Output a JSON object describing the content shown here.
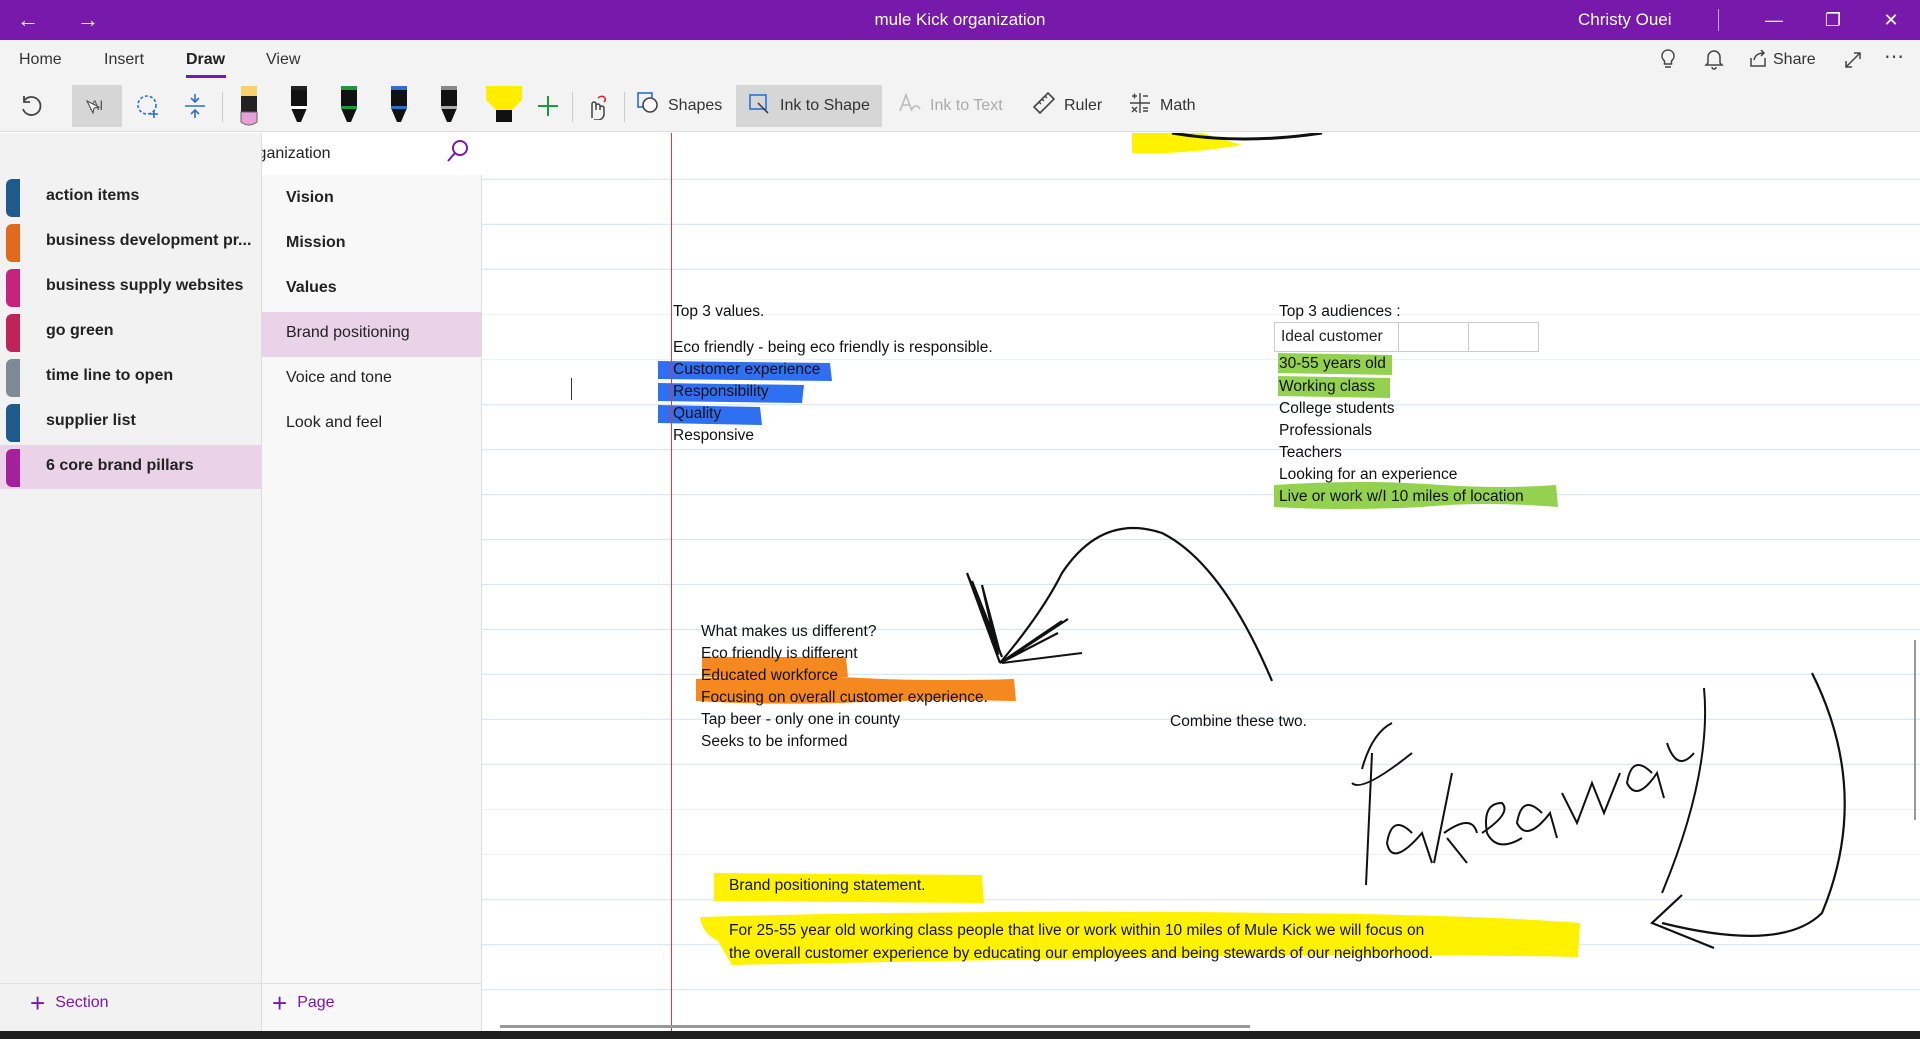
{
  "window": {
    "title": "mule Kick organization",
    "user": "Christy Ouei",
    "back_icon": "←",
    "forward_icon": "→",
    "minimize": "—",
    "restore": "❐",
    "close": "✕"
  },
  "ribbon": {
    "tabs": [
      "Home",
      "Insert",
      "Draw",
      "View"
    ],
    "active_tab": "Draw",
    "share_label": "Share"
  },
  "toolbar": {
    "shapes_label": "Shapes",
    "ink_to_shape_label": "Ink to Shape",
    "ink_to_text_label": "Ink to Text",
    "ruler_label": "Ruler",
    "math_label": "Math",
    "pens": [
      {
        "name": "highlighter-pink",
        "tip": "#e8a0d8"
      },
      {
        "name": "pen-black",
        "tip": "#111111"
      },
      {
        "name": "pen-green",
        "tip": "#1a9a3a"
      },
      {
        "name": "pen-blue",
        "tip": "#2b6fd6"
      },
      {
        "name": "pencil-gray",
        "tip": "#777777"
      },
      {
        "name": "highlighter-yellow",
        "tip": "#ffee00"
      }
    ],
    "accent": "#7719aa"
  },
  "notebook": {
    "title": "mule Kick organization",
    "sections": [
      {
        "label": "action items",
        "color": "#1e5a8c"
      },
      {
        "label": "business development pr...",
        "color": "#e06b1f"
      },
      {
        "label": "business supply websites",
        "color": "#c7237e"
      },
      {
        "label": "go green",
        "color": "#c0235a"
      },
      {
        "label": "time line to open",
        "color": "#7d8a94"
      },
      {
        "label": "supplier list",
        "color": "#1e5a8c"
      },
      {
        "label": "6 core brand pillars",
        "color": "#a3229b"
      }
    ],
    "active_section": "6 core brand pillars",
    "pages": [
      {
        "label": "Vision",
        "bold": true
      },
      {
        "label": "Mission",
        "bold": true
      },
      {
        "label": "Values",
        "bold": true
      },
      {
        "label": "Brand positioning",
        "bold": false
      },
      {
        "label": "Voice and tone",
        "bold": false
      },
      {
        "label": "Look and feel",
        "bold": false
      }
    ],
    "active_page": "Brand positioning",
    "add_section": "Section",
    "add_page": "Page"
  },
  "note": {
    "values_heading": "Top 3 values.",
    "values_intro": "Eco friendly - being eco friendly is responsible.",
    "values": [
      "Customer experience",
      "Responsibility",
      "Quality",
      "Responsive"
    ],
    "audiences_heading": "Top 3 audiences :",
    "audience_table_header": "Ideal customer",
    "audiences": [
      "30-55 years old",
      "Working class",
      "College students",
      "Professionals",
      "Teachers",
      "Looking for an experience",
      "Live or work w/I 10 miles of location"
    ],
    "different_heading": "What makes us different?",
    "different": [
      "Eco friendly is different",
      "Educated workforce",
      "Focusing on overall customer experience.",
      "Tap beer - only one in county",
      "Seeks to be informed"
    ],
    "combine_note": "Combine these two.",
    "handwriting": "takeaway",
    "statement_heading": "Brand positioning statement.",
    "statement_line1": "For 25-55 year old working class people that live or work within 10 miles of Mule Kick we will focus on",
    "statement_line2": "the overall customer experience by educating our employees and being stewards of our neighborhood.",
    "highlight_colors": {
      "blue": "#2f6ff2",
      "green": "#93d14f",
      "orange": "#f5891f",
      "yellow": "#fff200"
    }
  }
}
